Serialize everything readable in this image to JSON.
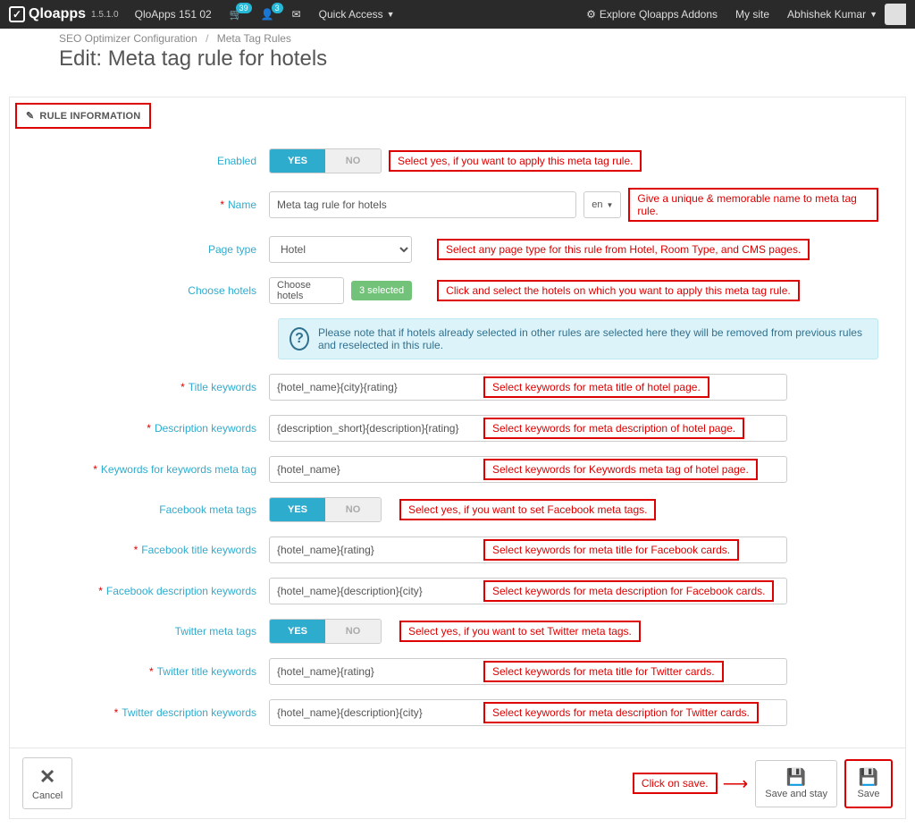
{
  "nav": {
    "brand_name": "Qloapps",
    "brand_version": "1.5.1.0",
    "shop_name": "QloApps 151 02",
    "cart_badge": "39",
    "user_badge": "3",
    "quick_access": "Quick Access",
    "explore": "Explore Qloapps Addons",
    "my_site": "My site",
    "admin_name": "Abhishek Kumar"
  },
  "breadcrumb": {
    "parent": "SEO Optimizer Configuration",
    "current": "Meta Tag Rules"
  },
  "page_title": "Edit: Meta tag rule for hotels",
  "panel_heading": "RULE INFORMATION",
  "form": {
    "enabled": {
      "label": "Enabled",
      "yes": "YES",
      "no": "NO",
      "hint": "Select yes, if you want to apply this meta tag rule."
    },
    "name": {
      "label": "Name",
      "value": "Meta tag rule for hotels",
      "lang": "en",
      "hint": "Give a unique & memorable name to meta tag rule."
    },
    "page_type": {
      "label": "Page type",
      "value": "Hotel",
      "hint": "Select any page type for this rule from Hotel, Room Type, and CMS pages."
    },
    "choose_hotels": {
      "label": "Choose hotels",
      "button": "Choose hotels",
      "badge": "3 selected",
      "hint": "Click and select the hotels on which you want to apply this meta tag rule."
    },
    "info_note": "Please note that if hotels already selected in other rules are selected here they will be removed from previous rules and reselected in this rule.",
    "title_keywords": {
      "label": "Title keywords",
      "value": "{hotel_name}{city}{rating}",
      "hint": "Select keywords for meta title of hotel page."
    },
    "desc_keywords": {
      "label": "Description keywords",
      "value": "{description_short}{description}{rating}",
      "hint": "Select keywords for meta description of hotel page."
    },
    "kw_keywords": {
      "label": "Keywords for keywords meta tag",
      "value": "{hotel_name}",
      "hint": "Select keywords for Keywords meta tag of hotel page."
    },
    "fb_toggle": {
      "label": "Facebook meta tags",
      "yes": "YES",
      "no": "NO",
      "hint": "Select yes, if you want to set Facebook meta tags."
    },
    "fb_title": {
      "label": "Facebook title keywords",
      "value": "{hotel_name}{rating}",
      "hint": "Select keywords for meta title for Facebook cards."
    },
    "fb_desc": {
      "label": "Facebook description keywords",
      "value": "{hotel_name}{description}{city}",
      "hint": "Select keywords for meta description for Facebook cards."
    },
    "tw_toggle": {
      "label": "Twitter meta tags",
      "yes": "YES",
      "no": "NO",
      "hint": "Select yes, if you want to set Twitter meta tags."
    },
    "tw_title": {
      "label": "Twitter title keywords",
      "value": "{hotel_name}{rating}",
      "hint": "Select keywords for meta title for Twitter cards."
    },
    "tw_desc": {
      "label": "Twitter description keywords",
      "value": "{hotel_name}{description}{city}",
      "hint": "Select keywords for meta description for Twitter cards."
    }
  },
  "footer": {
    "cancel": "Cancel",
    "save_stay": "Save and stay",
    "save": "Save",
    "annot": "Click on save."
  }
}
